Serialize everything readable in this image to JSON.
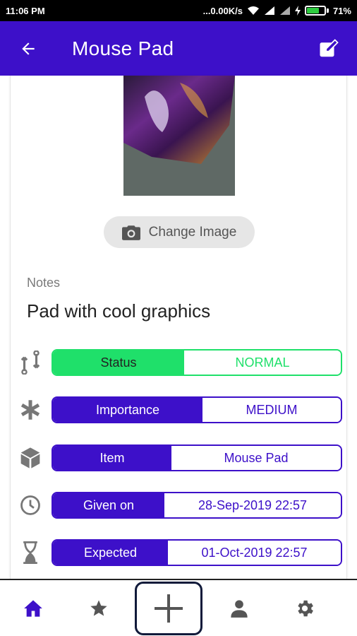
{
  "status_bar": {
    "time": "11:06 PM",
    "network_speed": "...0.00K/s",
    "battery": "71%",
    "battery_level": 0.71
  },
  "app_bar": {
    "title": "Mouse Pad",
    "back_icon": "arrow-left-icon",
    "edit_icon": "edit-note-icon",
    "color": "#3d10c9"
  },
  "image_section": {
    "change_button_label": "Change Image",
    "button_icon": "camera-icon"
  },
  "notes": {
    "label": "Notes",
    "value": "Pad with cool graphics"
  },
  "fields": [
    {
      "icon": "compare-arrows-icon",
      "key": "Status",
      "value": "NORMAL",
      "color": "#1fe06a"
    },
    {
      "icon": "asterisk-icon",
      "key": "Importance",
      "value": "MEDIUM",
      "color": "#3d10c9"
    },
    {
      "icon": "cube-icon",
      "key": "Item",
      "value": "Mouse Pad",
      "color": "#3d10c9"
    },
    {
      "icon": "clock-icon",
      "key": "Given on",
      "value": "28-Sep-2019 22:57",
      "color": "#3d10c9"
    },
    {
      "icon": "hourglass-icon",
      "key": "Expected",
      "value": "01-Oct-2019 22:57",
      "color": "#3d10c9"
    }
  ],
  "bottom_nav": {
    "items": [
      "home-icon",
      "star-icon",
      "add-icon",
      "person-icon",
      "gear-icon"
    ],
    "active": "home-icon"
  }
}
